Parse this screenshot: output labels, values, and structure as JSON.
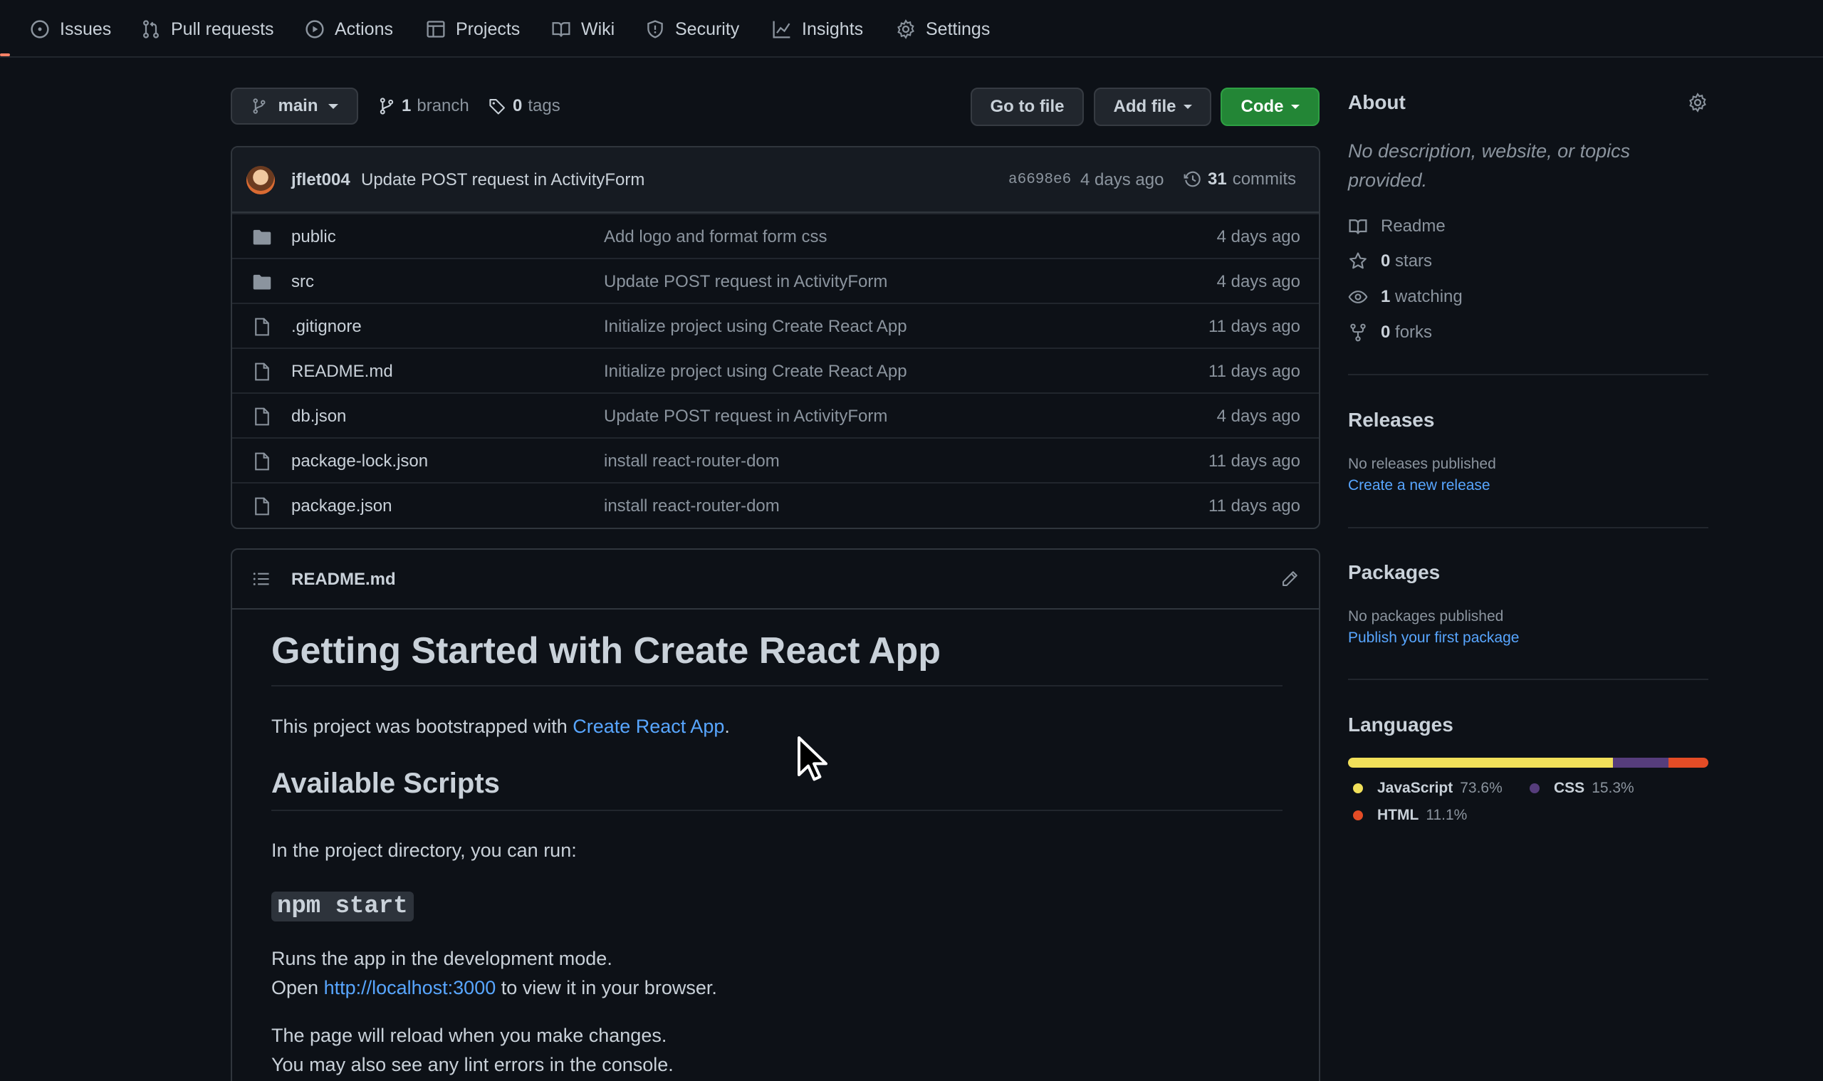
{
  "nav": {
    "tabs": [
      {
        "label": "Issues",
        "icon": "issue-opened-icon"
      },
      {
        "label": "Pull requests",
        "icon": "git-pull-request-icon"
      },
      {
        "label": "Actions",
        "icon": "play-icon"
      },
      {
        "label": "Projects",
        "icon": "table-icon"
      },
      {
        "label": "Wiki",
        "icon": "book-icon"
      },
      {
        "label": "Security",
        "icon": "shield-icon"
      },
      {
        "label": "Insights",
        "icon": "graph-icon"
      },
      {
        "label": "Settings",
        "icon": "gear-icon"
      }
    ]
  },
  "repo_bar": {
    "branch": "main",
    "branch_count": "1",
    "branch_label": "branch",
    "tag_count": "0",
    "tag_label": "tags",
    "go_to_file": "Go to file",
    "add_file": "Add file",
    "code": "Code"
  },
  "latest_commit": {
    "author": "jflet004",
    "message": "Update POST request in ActivityForm",
    "sha": "a6698e6",
    "time": "4 days ago",
    "commit_count": "31",
    "commit_label": "commits"
  },
  "files": [
    {
      "type": "dir",
      "name": "public",
      "message": "Add logo and format form css",
      "age": "4 days ago"
    },
    {
      "type": "dir",
      "name": "src",
      "message": "Update POST request in ActivityForm",
      "age": "4 days ago"
    },
    {
      "type": "file",
      "name": ".gitignore",
      "message": "Initialize project using Create React App",
      "age": "11 days ago"
    },
    {
      "type": "file",
      "name": "README.md",
      "message": "Initialize project using Create React App",
      "age": "11 days ago"
    },
    {
      "type": "file",
      "name": "db.json",
      "message": "Update POST request in ActivityForm",
      "age": "4 days ago"
    },
    {
      "type": "file",
      "name": "package-lock.json",
      "message": "install react-router-dom",
      "age": "11 days ago"
    },
    {
      "type": "file",
      "name": "package.json",
      "message": "install react-router-dom",
      "age": "11 days ago"
    }
  ],
  "readme": {
    "filename": "README.md",
    "h1": "Getting Started with Create React App",
    "intro_before": "This project was bootstrapped with ",
    "intro_link": "Create React App",
    "intro_after": ".",
    "h2": "Available Scripts",
    "p_run": "In the project directory, you can run:",
    "code": "npm start",
    "p_dev": "Runs the app in the development mode.",
    "open_before": "Open ",
    "open_link": "http://localhost:3000",
    "open_after": " to view it in your browser.",
    "p_reload": "The page will reload when you make changes.",
    "p_lint": "You may also see any lint errors in the console."
  },
  "about": {
    "title": "About",
    "description": "No description, website, or topics provided.",
    "readme": "Readme",
    "stars_count": "0",
    "stars_label": "stars",
    "watching_count": "1",
    "watching_label": "watching",
    "forks_count": "0",
    "forks_label": "forks"
  },
  "releases": {
    "title": "Releases",
    "empty": "No releases published",
    "link": "Create a new release"
  },
  "packages": {
    "title": "Packages",
    "empty": "No packages published",
    "link": "Publish your first package"
  },
  "languages": {
    "title": "Languages",
    "items": [
      {
        "name": "JavaScript",
        "percent": "73.6%",
        "value": 73.6,
        "color": "#f1e05a"
      },
      {
        "name": "CSS",
        "percent": "15.3%",
        "value": 15.3,
        "color": "#563d7c"
      },
      {
        "name": "HTML",
        "percent": "11.1%",
        "value": 11.1,
        "color": "#e34c26"
      }
    ]
  },
  "colors": {
    "background": "#0d1117",
    "border": "#30363d",
    "link": "#58a6ff",
    "code_button": "#238636",
    "active_tab_underline": "#f78166"
  }
}
